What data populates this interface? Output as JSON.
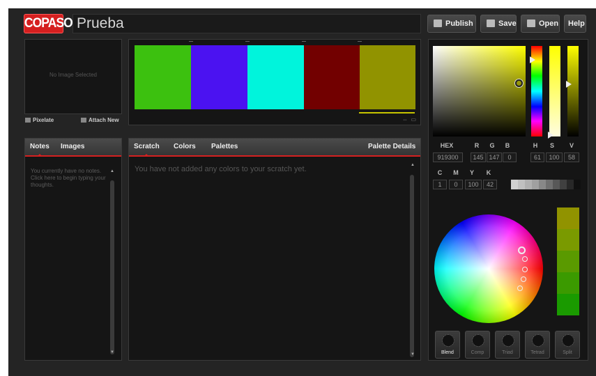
{
  "header": {
    "logo": "COPASO",
    "title": "Prueba",
    "buttons": {
      "publish": "Publish",
      "save": "Save",
      "open": "Open",
      "help": "Help"
    }
  },
  "image_panel": {
    "empty_message": "No Image Selected",
    "pixelate": "Pixelate",
    "attach": "Attach New"
  },
  "palette": {
    "swatches": [
      {
        "hex": "#3cc10f"
      },
      {
        "hex": "#4b12f1"
      },
      {
        "hex": "#00f4dc"
      },
      {
        "hex": "#720000"
      },
      {
        "hex": "#919300"
      }
    ]
  },
  "notes": {
    "tabs": [
      "Notes",
      "Images"
    ],
    "empty_text": "You currently have no notes. Click here to begin typing your thoughts."
  },
  "scratch": {
    "tabs": [
      "Scratch",
      "Colors",
      "Palettes"
    ],
    "details": "Palette Details",
    "empty_text": "You have not added any colors to your scratch yet."
  },
  "picker": {
    "labels": {
      "hex": "HEX",
      "r": "R",
      "g": "G",
      "b": "B",
      "h": "H",
      "s": "S",
      "v": "V",
      "c": "C",
      "m": "M",
      "y": "Y",
      "k": "K"
    },
    "values": {
      "hex": "919300",
      "r": "145",
      "g": "147",
      "b": "0",
      "h": "61",
      "s": "100",
      "v": "58",
      "c": "1",
      "m": "0",
      "y": "100",
      "k": "42"
    },
    "grays": [
      "#d0d0d0",
      "#c0c0c0",
      "#b0b0b0",
      "#a0a0a0",
      "#888888",
      "#707070",
      "#585858",
      "#404040",
      "#282828",
      "#101010"
    ],
    "side_swatches": [
      "#919300",
      "#7a9a00",
      "#5a9a00",
      "#3b9a00",
      "#1a9a00"
    ],
    "harmonies": [
      "Blend",
      "Comp",
      "Triad",
      "Tetrad",
      "Split"
    ]
  }
}
